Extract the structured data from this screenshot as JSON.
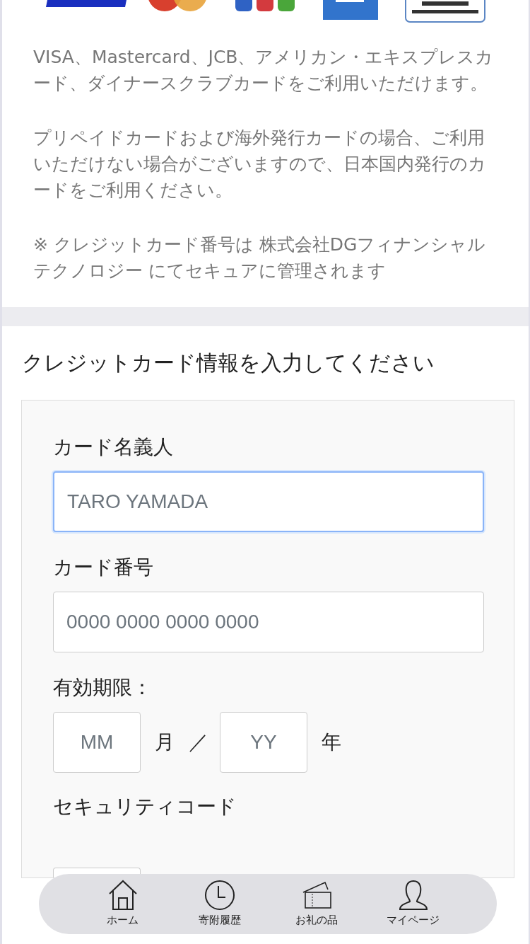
{
  "notes": [
    "VISA、Mastercard、JCB、アメリカン・エキスプレスカード、ダイナースクラブカードをご利用いただけます。",
    "プリペイドカードおよび海外発行カードの場合、ご利用いただけない場合がございますので、日本国内発行のカードをご利用ください。",
    "※ クレジットカード番号は 株式会社DGフィナンシャルテクノロジー にてセキュアに管理されます"
  ],
  "section_title": "クレジットカード情報を入力してください",
  "form": {
    "fields": [
      {
        "kind": "text",
        "label": "カード名義人",
        "placeholder": "TARO YAMADA",
        "focused": true
      },
      {
        "kind": "text",
        "label": "カード番号",
        "placeholder": "0000 0000 0000 0000",
        "focused": false
      },
      {
        "kind": "expiry",
        "label": "有効期限：",
        "month_placeholder": "MM",
        "month_unit": "月",
        "separator": "／",
        "year_placeholder": "YY",
        "year_unit": "年"
      },
      {
        "kind": "short",
        "label": "セキュリティコード",
        "focused": false
      }
    ]
  },
  "bottom_nav": [
    {
      "label": "ホーム"
    },
    {
      "label": "寄附履歴"
    },
    {
      "label": "お礼の品"
    },
    {
      "label": "マイページ"
    }
  ]
}
